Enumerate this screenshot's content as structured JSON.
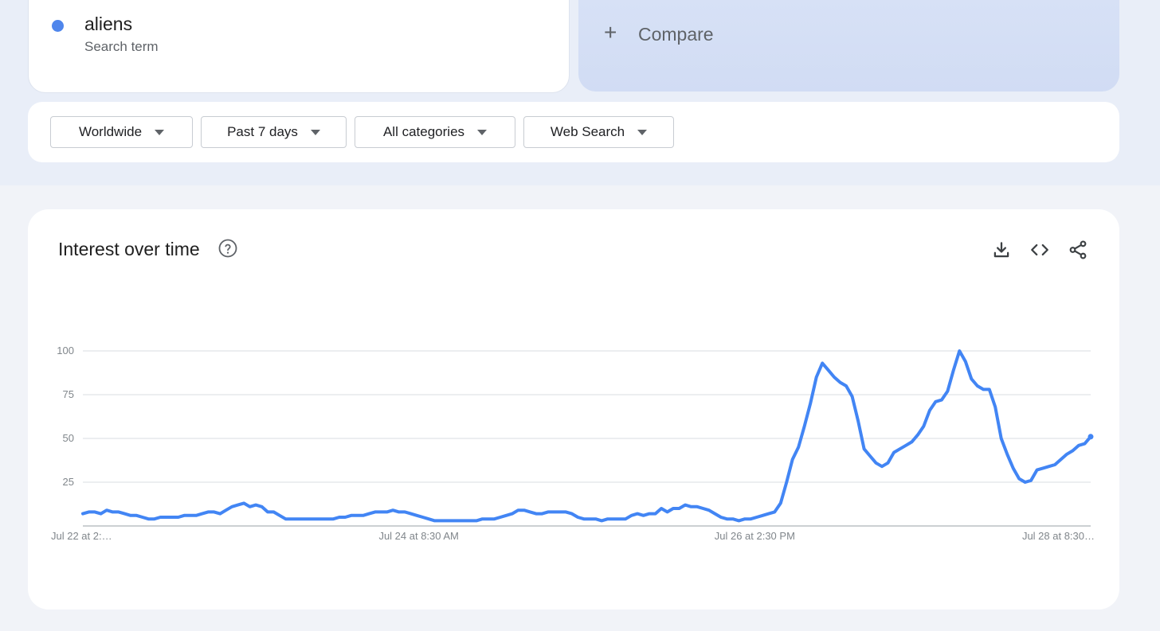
{
  "search_term": {
    "name": "aliens",
    "type_label": "Search term",
    "color": "#4f86ec"
  },
  "compare": {
    "icon": "plus-icon",
    "label": "Compare"
  },
  "filters": {
    "region": "Worldwide",
    "time_range": "Past 7 days",
    "category": "All categories",
    "search_type": "Web Search"
  },
  "chart_card": {
    "title": "Interest over time",
    "help_icon": "help-circle-icon",
    "tools": [
      "download-icon",
      "embed-code-icon",
      "share-icon"
    ]
  },
  "chart_data": {
    "type": "line",
    "ylim": [
      0,
      100
    ],
    "yticks": [
      25,
      50,
      75,
      100
    ],
    "xtick_labels": [
      "Jul 22 at 2:…",
      "Jul 24 at 8:30 AM",
      "Jul 26 at 2:30 PM",
      "Jul 28 at 8:30…"
    ],
    "series": [
      {
        "name": "aliens",
        "color": "#4285f4",
        "values": [
          7,
          8,
          8,
          7,
          9,
          8,
          8,
          7,
          6,
          6,
          5,
          4,
          4,
          5,
          5,
          5,
          5,
          6,
          6,
          6,
          7,
          8,
          8,
          7,
          9,
          11,
          12,
          13,
          11,
          12,
          11,
          8,
          8,
          6,
          4,
          4,
          4,
          4,
          4,
          4,
          4,
          4,
          4,
          5,
          5,
          6,
          6,
          6,
          7,
          8,
          8,
          8,
          9,
          8,
          8,
          7,
          6,
          5,
          4,
          3,
          3,
          3,
          3,
          3,
          3,
          3,
          3,
          4,
          4,
          4,
          5,
          6,
          7,
          9,
          9,
          8,
          7,
          7,
          8,
          8,
          8,
          8,
          7,
          5,
          4,
          4,
          4,
          3,
          4,
          4,
          4,
          4,
          6,
          7,
          6,
          7,
          7,
          10,
          8,
          10,
          10,
          12,
          11,
          11,
          10,
          9,
          7,
          5,
          4,
          4,
          3,
          4,
          4,
          5,
          6,
          7,
          8,
          13,
          25,
          38,
          45,
          57,
          70,
          85,
          93,
          89,
          85,
          82,
          80,
          74,
          60,
          44,
          40,
          36,
          34,
          36,
          42,
          44,
          46,
          48,
          52,
          57,
          66,
          71,
          72,
          77,
          89,
          100,
          94,
          84,
          80,
          78,
          78,
          68,
          50,
          41,
          33,
          27,
          25,
          26,
          32,
          33,
          34,
          35,
          38,
          41,
          43,
          46,
          47,
          51
        ]
      }
    ]
  }
}
